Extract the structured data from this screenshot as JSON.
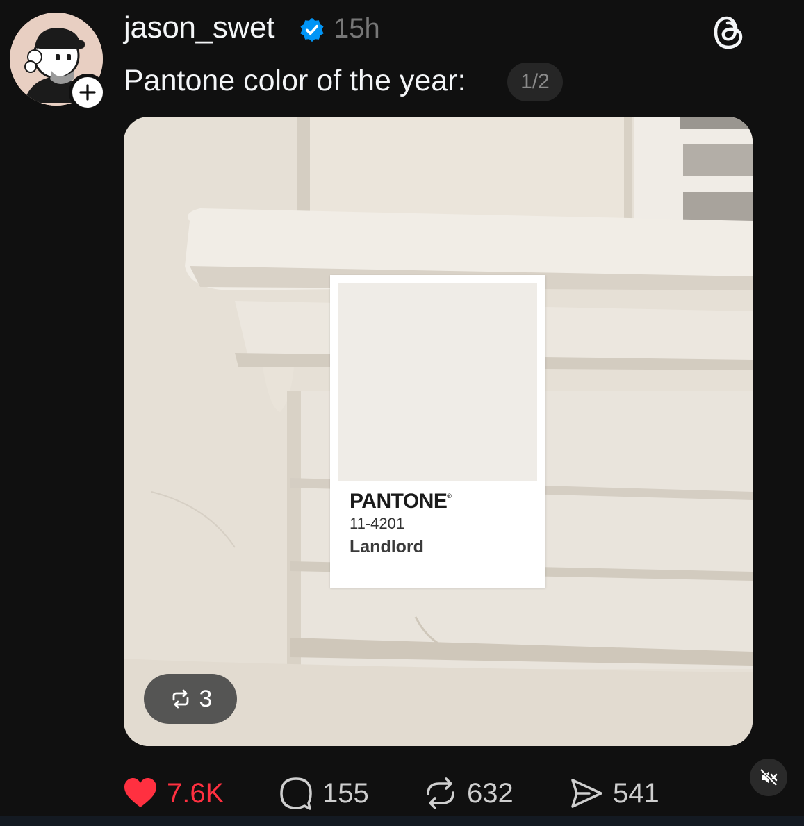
{
  "post": {
    "username": "jason_swet",
    "time": "15h",
    "caption": "Pantone color of the year:",
    "page_indicator": "1/2"
  },
  "swatch": {
    "brand": "PANTONE",
    "code": "11-4201",
    "name": "Landlord"
  },
  "media": {
    "repost_count": "3"
  },
  "actions": {
    "likes": "7.6K",
    "comments": "155",
    "reposts": "632",
    "shares": "541"
  },
  "colors": {
    "like": "#ff3040",
    "verified": "#0095f6",
    "background": "#101010"
  },
  "icons": [
    "threads-logo-icon",
    "verified-badge-icon",
    "plus-icon",
    "heart-icon",
    "comment-icon",
    "repost-icon",
    "share-icon",
    "mute-icon"
  ]
}
